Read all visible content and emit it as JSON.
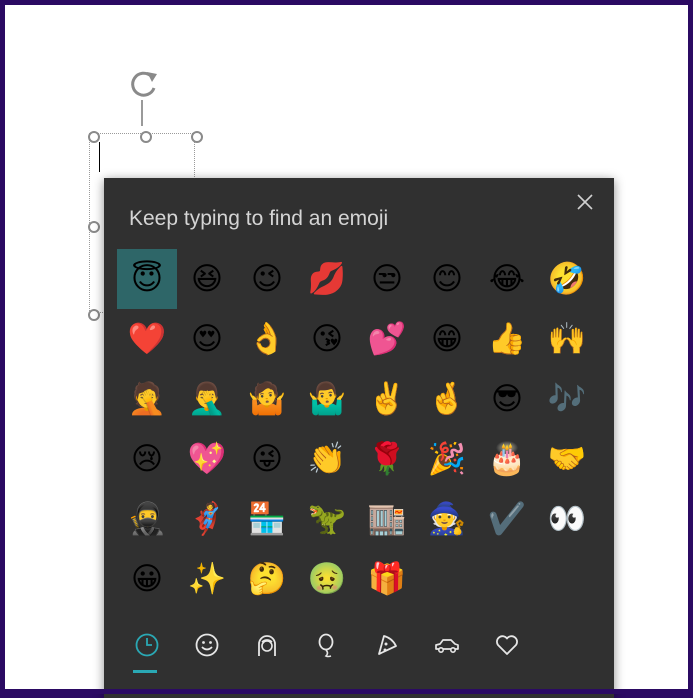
{
  "panel": {
    "prompt": "Keep typing to find an emoji",
    "close_icon": "close-icon"
  },
  "emojis": [
    "😇",
    "😆",
    "😉",
    "💋",
    "😒",
    "😊",
    "😂",
    "🤣",
    "❤️",
    "😍",
    "👌",
    "😘",
    "💕",
    "😁",
    "👍",
    "🙌",
    "🤦",
    "🤦‍♂️",
    "🤷",
    "🤷‍♂️",
    "✌️",
    "🤞",
    "😎",
    "🎶",
    "😢",
    "💖",
    "😜",
    "👏",
    "🌹",
    "🎉",
    "🎂",
    "🤝",
    "🥷",
    "🦸",
    "🏪",
    "🦖",
    "🏬",
    "🧙",
    "✔️",
    "👀",
    "😀",
    "✨",
    "🤔",
    "🤢",
    "🎁"
  ],
  "selected_index": 0,
  "category_tabs": [
    {
      "name": "recent",
      "icon": "clock-icon",
      "active": true
    },
    {
      "name": "smileys",
      "icon": "smiley-icon",
      "active": false
    },
    {
      "name": "people",
      "icon": "person-icon",
      "active": false
    },
    {
      "name": "celebration",
      "icon": "balloon-icon",
      "active": false
    },
    {
      "name": "food",
      "icon": "pizza-icon",
      "active": false
    },
    {
      "name": "travel",
      "icon": "car-icon",
      "active": false
    },
    {
      "name": "symbols",
      "icon": "heart-icon",
      "active": false
    }
  ],
  "colors": {
    "frame": "#2b0a63",
    "panel": "#303030",
    "selected": "#2e6668",
    "accent": "#2aa8b4",
    "icon": "#e6e6e6"
  }
}
